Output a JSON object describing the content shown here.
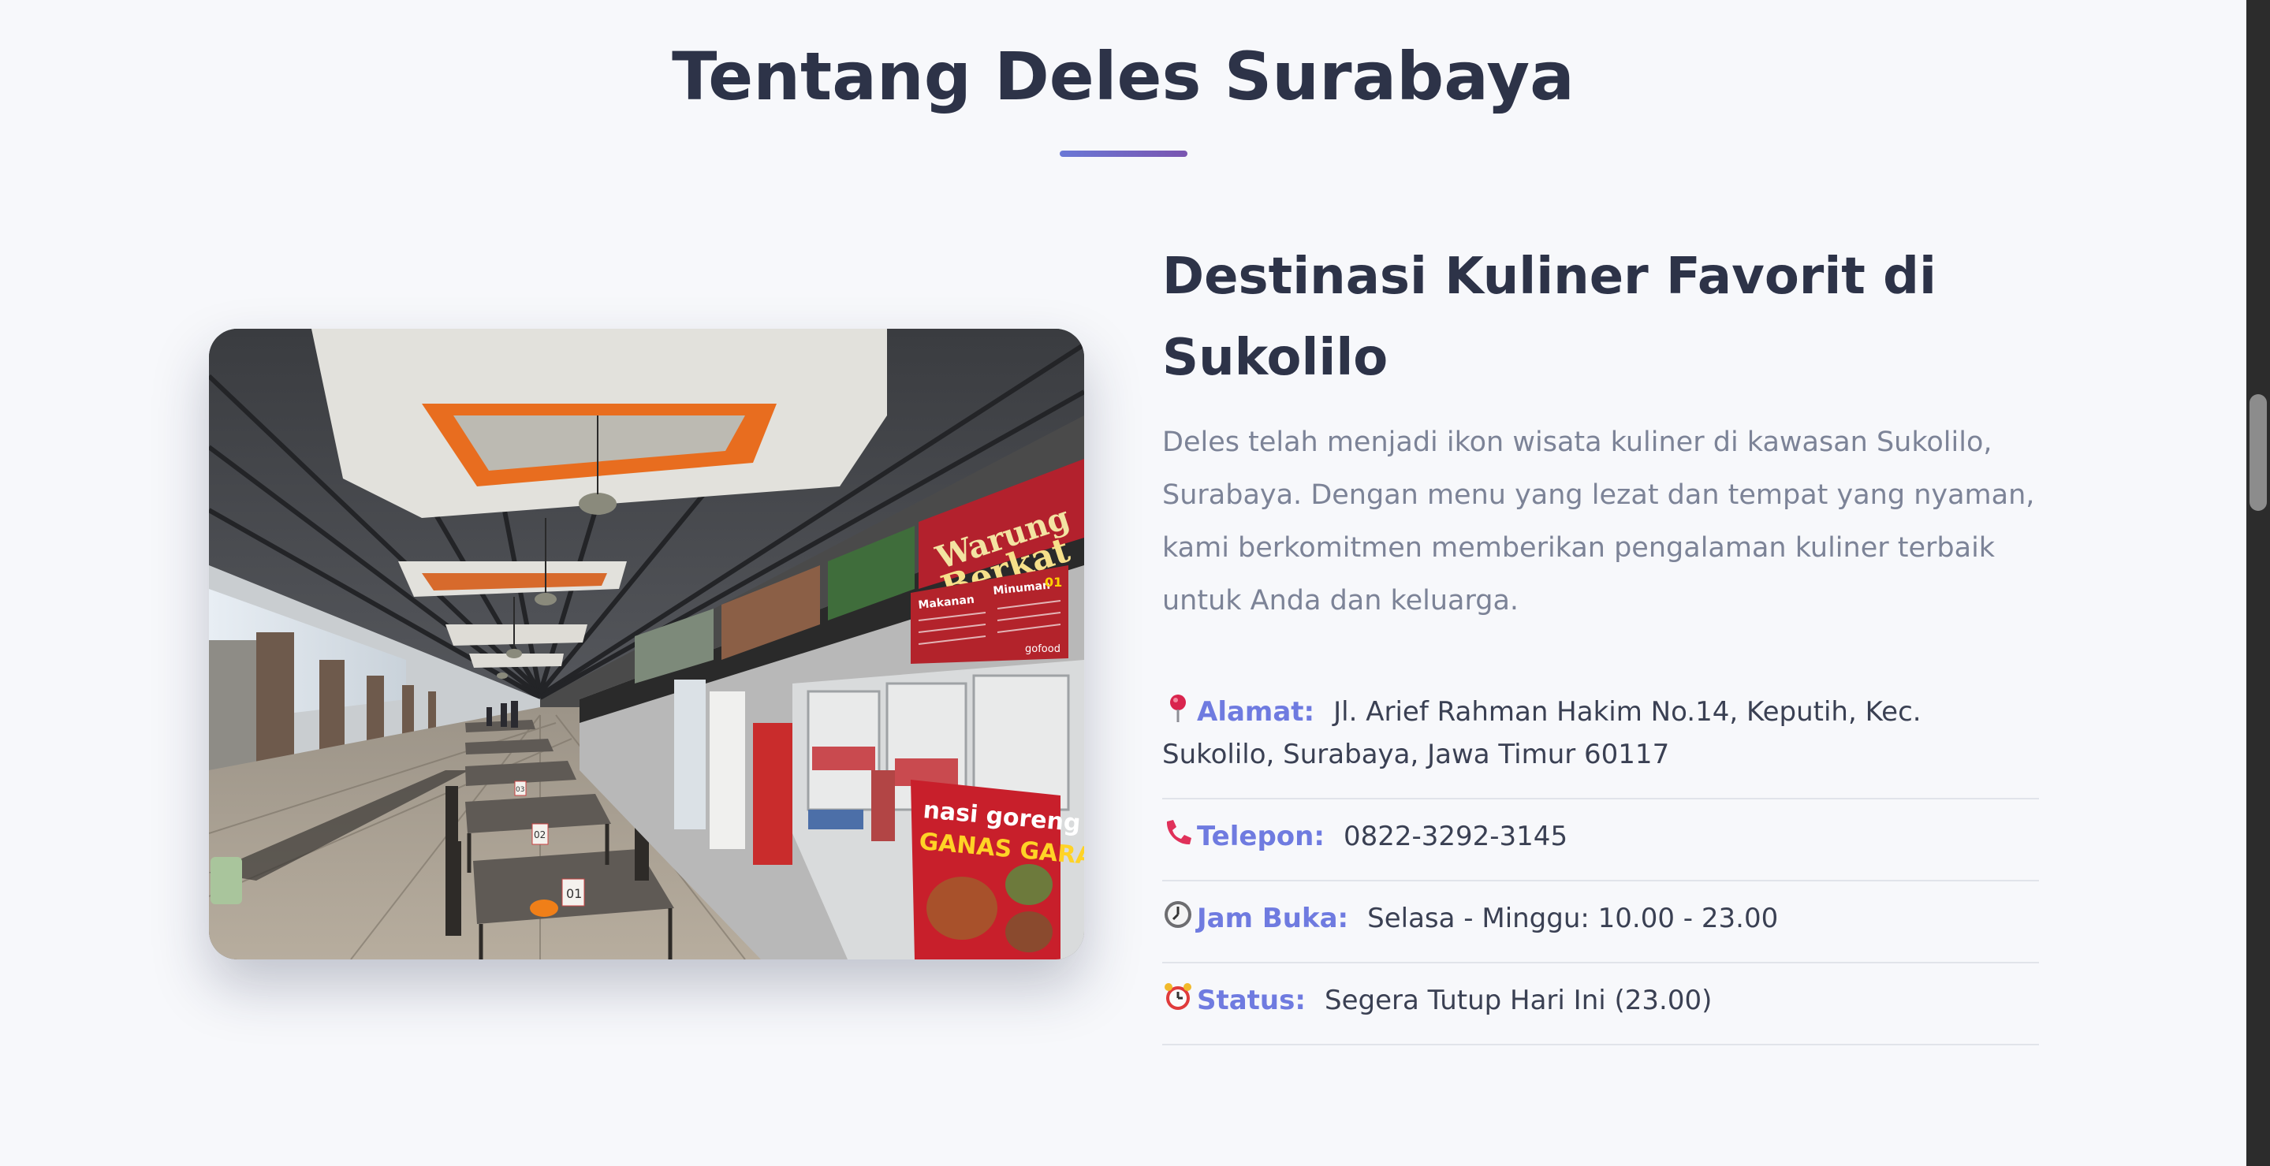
{
  "about": {
    "section_title": "Tentang Deles Surabaya",
    "heading": "Destinasi Kuliner Favorit di Sukolilo",
    "description": "Deles telah menjadi ikon wisata kuliner di kawasan Sukolilo, Surabaya. Dengan menu yang lezat dan tempat yang nyaman, kami berkomitmen memberikan pengalaman kuliner terbaik untuk Anda dan keluarga.",
    "photo_signs": {
      "stall_1_line1": "Warung",
      "stall_1_line2": "Berkat",
      "stall_2_line1": "nasi goreng",
      "stall_2_line2": "GANAS GARAS",
      "menu_left": "Makanan",
      "menu_right": "Minuman",
      "menu_number": "01",
      "table_1": "01",
      "table_2": "02",
      "table_3": "03",
      "delivery": "gofood"
    }
  },
  "info": [
    {
      "icon": "pin-icon",
      "label": "Alamat:",
      "value": "Jl. Arief Rahman Hakim No.14, Keputih, Kec. Sukolilo, Surabaya, Jawa Timur 60117"
    },
    {
      "icon": "phone-icon",
      "label": "Telepon:",
      "value": "0822-3292-3145"
    },
    {
      "icon": "clock-icon",
      "label": "Jam Buka:",
      "value": "Selasa - Minggu: 10.00 - 23.00"
    },
    {
      "icon": "alarm-clock-icon",
      "label": "Status:",
      "value": "Segera Tutup Hari Ini (23.00)"
    }
  ],
  "colors": {
    "accent": "#6f7be0",
    "heading": "#2d3348",
    "body_text": "#7c8397",
    "underline_start": "#6a78d6",
    "underline_end": "#7a55b0"
  }
}
